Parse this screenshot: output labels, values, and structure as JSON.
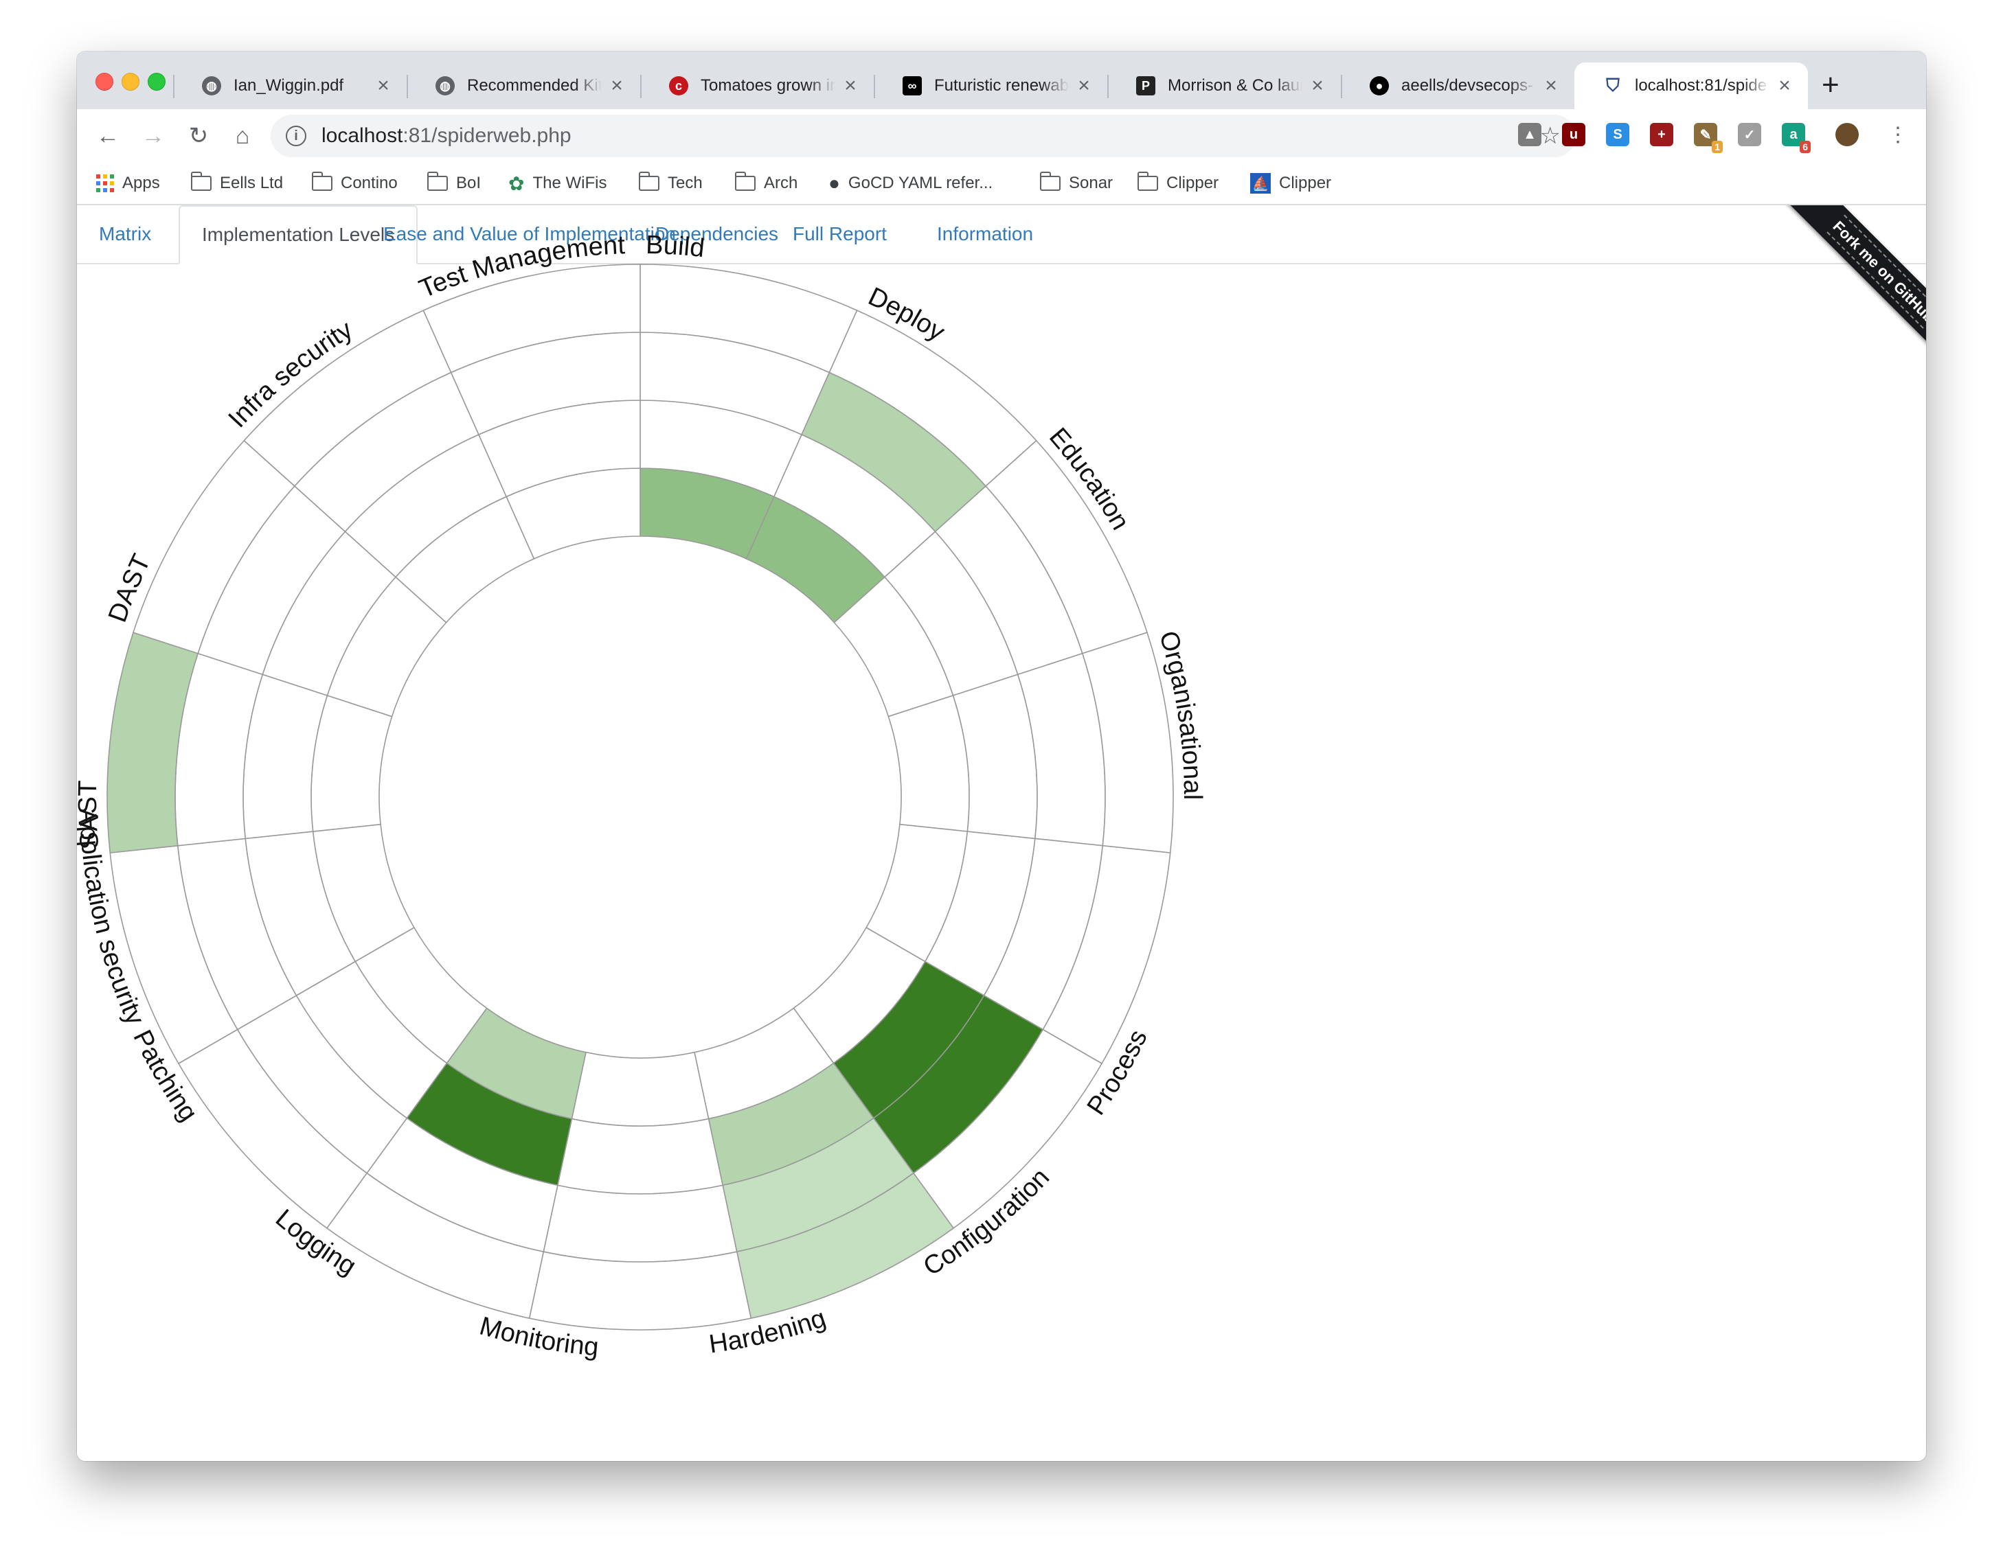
{
  "browser": {
    "tabs": [
      {
        "title": "Ian_Wiggin.pdf",
        "icon": "globe-icon",
        "icon_color": "#5f6368",
        "active": false
      },
      {
        "title": "Recommended Kit",
        "icon": "globe-icon",
        "icon_color": "#5f6368",
        "active": false
      },
      {
        "title": "Tomatoes grown in",
        "icon": "cnet-icon",
        "icon_color": "#c4161c",
        "active": false
      },
      {
        "title": "Futuristic renewab",
        "icon": "abc-icon",
        "icon_color": "#000000",
        "active": false
      },
      {
        "title": "Morrison & Co laun",
        "icon": "pei-icon",
        "icon_color": "#222222",
        "active": false
      },
      {
        "title": "aeells/devsecops-",
        "icon": "github-icon",
        "icon_color": "#000000",
        "active": false
      },
      {
        "title": "localhost:81/spide",
        "icon": "shield-icon",
        "icon_color": "#2b4a8b",
        "active": true
      }
    ],
    "tab_close_glyph": "×",
    "new_tab_glyph": "+",
    "address": {
      "host": "localhost",
      "path": ":81/spiderweb.php"
    },
    "extensions": [
      {
        "name": "drive-icon",
        "color": "#7b7b7b",
        "label": "▲",
        "badge": ""
      },
      {
        "name": "ublock-icon",
        "color": "#800000",
        "label": "u",
        "badge": ""
      },
      {
        "name": "s-icon",
        "color": "#2c8ee3",
        "label": "S",
        "badge": ""
      },
      {
        "name": "plus-shield-icon",
        "color": "#9b1b1b",
        "label": "+",
        "badge": ""
      },
      {
        "name": "cartoon-icon",
        "color": "#8a6d3b",
        "label": "✎",
        "badge": "1"
      },
      {
        "name": "check-icon",
        "color": "#9e9e9e",
        "label": "✓",
        "badge": ""
      },
      {
        "name": "grammarly-icon",
        "color": "#15a083",
        "label": "a",
        "badge": "6"
      }
    ],
    "bookmarks": [
      {
        "label": "Apps",
        "icon": "apps-grid-icon"
      },
      {
        "label": "Eells Ltd",
        "icon": "folder-icon"
      },
      {
        "label": "Contino",
        "icon": "folder-icon"
      },
      {
        "label": "BoI",
        "icon": "folder-icon"
      },
      {
        "label": "The WiFis",
        "icon": "wifis-icon"
      },
      {
        "label": "Tech",
        "icon": "folder-icon"
      },
      {
        "label": "Arch",
        "icon": "folder-icon"
      },
      {
        "label": "GoCD YAML refer...",
        "icon": "github-icon"
      },
      {
        "label": "Sonar",
        "icon": "folder-icon"
      },
      {
        "label": "Clipper",
        "icon": "folder-icon"
      },
      {
        "label": "Clipper",
        "icon": "clipper-icon"
      }
    ]
  },
  "page": {
    "tabs": [
      {
        "label": "Matrix",
        "active": false
      },
      {
        "label": "Implementation Levels",
        "active": true
      },
      {
        "label": "Ease and Value of Implementation",
        "active": false
      },
      {
        "label": "Dependencies",
        "active": false
      },
      {
        "label": "Full Report",
        "active": false
      },
      {
        "label": "Information",
        "active": false
      }
    ],
    "ribbon": "Fork me on GitHub"
  },
  "chart_data": {
    "type": "radial-heatmap",
    "levels": 4,
    "categories": [
      "Build",
      "Deploy",
      "Education",
      "Organisational",
      "Process",
      "Configuration",
      "Hardening",
      "Monitoring",
      "Logging",
      "Patching",
      "Application security",
      "SAST",
      "DAST",
      "Infra security",
      "Test Management"
    ],
    "level_colors": [
      "#ffffff",
      "#c5dfc1",
      "#b3d4ad",
      "#8fbf85",
      "#387d22"
    ],
    "cells": [
      [
        3,
        0,
        0,
        0
      ],
      [
        3,
        0,
        2,
        0
      ],
      [
        0,
        0,
        0,
        0
      ],
      [
        0,
        0,
        0,
        0
      ],
      [
        0,
        0,
        0,
        0
      ],
      [
        0,
        4,
        4,
        0
      ],
      [
        0,
        2,
        1,
        1
      ],
      [
        0,
        0,
        0,
        0
      ],
      [
        2,
        4,
        0,
        0
      ],
      [
        0,
        0,
        0,
        0
      ],
      [
        0,
        0,
        0,
        0
      ],
      [
        0,
        0,
        0,
        2
      ],
      [
        0,
        0,
        0,
        0
      ],
      [
        0,
        0,
        0,
        0
      ],
      [
        0,
        0,
        0,
        0
      ]
    ]
  }
}
